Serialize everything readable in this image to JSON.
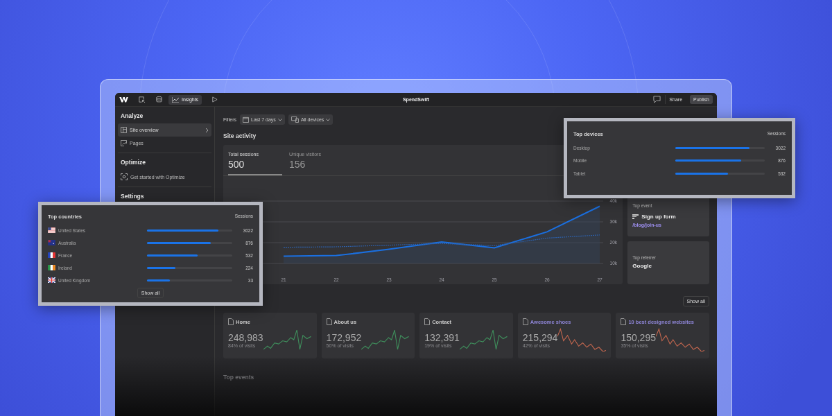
{
  "topbar": {
    "tabs": [
      {
        "label": "Insights",
        "selected": true
      }
    ],
    "title": "SpendSwift",
    "buttons": [
      {
        "label": "Share",
        "kind": "plain"
      },
      {
        "label": "Publish",
        "kind": "filled"
      }
    ]
  },
  "sidebar": {
    "sections": [
      {
        "heading": "Analyze",
        "items": [
          {
            "label": "Site overview",
            "kind": "layout",
            "selected": true
          },
          {
            "label": "Pages",
            "kind": "pages",
            "selected": false
          }
        ]
      },
      {
        "heading": "Optimize",
        "items": [
          {
            "label": "Get started with Optimize",
            "kind": "target",
            "selected": false
          }
        ]
      },
      {
        "heading": "Settings"
      }
    ]
  },
  "filters": {
    "label": "Filters",
    "options": [
      {
        "label": "Last 7 days",
        "kind": "date"
      },
      {
        "label": "All devices",
        "kind": "device"
      }
    ]
  },
  "site_activity": {
    "title": "Site activity",
    "metrics": [
      {
        "label": "Total sessions",
        "value": "500",
        "selected": true
      },
      {
        "label": "Unique visitors",
        "value": "156",
        "selected": false
      }
    ],
    "chart_data": {
      "type": "area",
      "categories": [
        "21",
        "22",
        "23",
        "24",
        "25",
        "26",
        "27"
      ],
      "grid": true,
      "ylim": [
        10000,
        40000
      ],
      "series": [
        {
          "color": "#1a6fe0",
          "line_style": "solid",
          "type": "area",
          "values": [
            13500,
            13800,
            16800,
            20300,
            17500,
            25200,
            37500
          ]
        },
        {
          "color": "#2d5fa8",
          "line_style": "dashed",
          "type": "line",
          "values": [
            17800,
            18000,
            18800,
            19600,
            18600,
            22200,
            23700
          ]
        }
      ],
      "yticks": [
        {
          "value": 10000,
          "label": "10k"
        },
        {
          "value": 20000,
          "label": "20k"
        },
        {
          "value": 30000,
          "label": "30k"
        },
        {
          "value": 40000,
          "label": "40k"
        }
      ]
    }
  },
  "top_event": {
    "label": "Top event",
    "name": "Sign up form",
    "path": "/blog/join-us"
  },
  "top_referrer": {
    "label": "Top referrer",
    "name": "Google"
  },
  "pages": {
    "show_all": "Show all",
    "cards": [
      {
        "title": "Home",
        "value": "248,983",
        "share": "84% of visits",
        "kind": "rising"
      },
      {
        "title": "About us",
        "value": "172,952",
        "share": "50% of visits",
        "kind": "rising"
      },
      {
        "title": "Contact",
        "value": "132,391",
        "share": "19% of visits",
        "kind": "rising"
      },
      {
        "title": "Awesome shoes",
        "value": "215,294",
        "share": "42% of visits",
        "kind": "falling"
      },
      {
        "title": "10 best designed websites",
        "value": "150,295",
        "share": "35% of visits",
        "kind": "falling"
      }
    ]
  },
  "top_events": {
    "title": "Top events"
  },
  "top_countries": {
    "title": "Top countries",
    "column": "Sessions",
    "rows": [
      {
        "name": "United States",
        "kind": "us",
        "level": 0.84,
        "value": "3022"
      },
      {
        "name": "Australia",
        "kind": "au",
        "level": 0.75,
        "value": "876"
      },
      {
        "name": "France",
        "kind": "fr",
        "level": 0.59,
        "value": "532"
      },
      {
        "name": "Ireland",
        "kind": "ie",
        "level": 0.33,
        "value": "224"
      },
      {
        "name": "United Kingdom",
        "kind": "uk",
        "level": 0.27,
        "value": "33"
      }
    ],
    "show_all": "Show all"
  },
  "top_devices": {
    "title": "Top devices",
    "column": "Sessions",
    "rows": [
      {
        "name": "Desktop",
        "level": 0.83,
        "value": "3022"
      },
      {
        "name": "Mobile",
        "level": 0.74,
        "value": "876"
      },
      {
        "name": "Tablet",
        "level": 0.59,
        "value": "532"
      }
    ]
  }
}
